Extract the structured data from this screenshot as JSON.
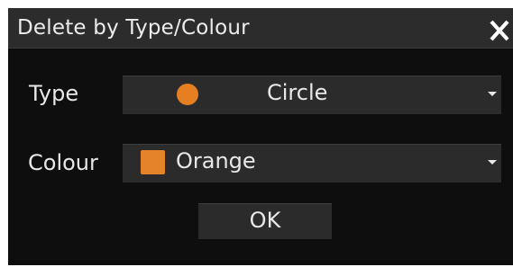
{
  "dialog": {
    "title": "Delete by Type/Colour"
  },
  "fields": {
    "type_label": "Type",
    "type_value": "Circle",
    "colour_label": "Colour",
    "colour_value": "Orange"
  },
  "buttons": {
    "ok_label": "OK"
  },
  "icons": {
    "close": "close-icon",
    "type_symbol": "circle-icon",
    "colour_swatch": "color-swatch-icon",
    "dropdown": "chevron-down-icon"
  },
  "colors": {
    "title_bar": "#2c2c2c",
    "background": "#0e0e0e",
    "control": "#2b2b2b",
    "text": "#e8e8e8",
    "orange": "#e67e22"
  }
}
